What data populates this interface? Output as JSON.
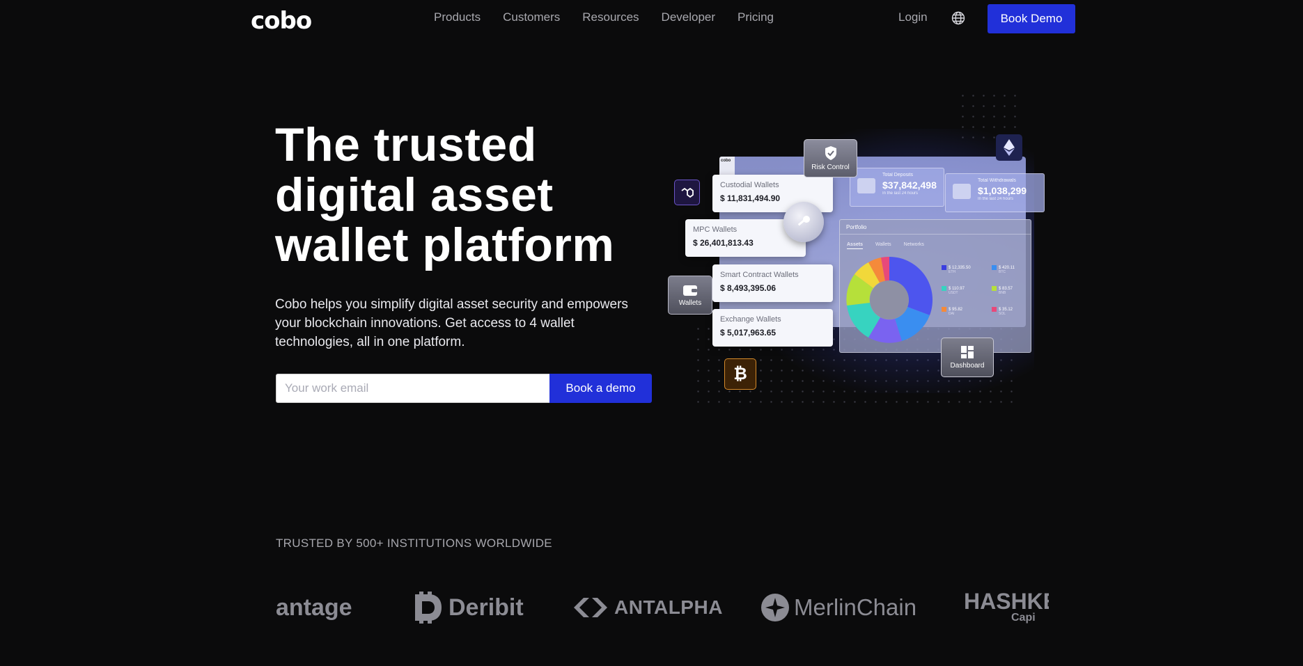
{
  "nav": {
    "logo": "cobo",
    "links": [
      "Products",
      "Customers",
      "Resources",
      "Developer",
      "Pricing"
    ],
    "login": "Login",
    "cta": "Book Demo",
    "globe_icon": "globe-icon"
  },
  "hero": {
    "title_line1": "The trusted",
    "title_line2": "digital asset",
    "title_line3": "wallet platform",
    "subtitle": "Cobo helps you simplify digital asset security and empowers your blockchain innovations. Get access to 4 wallet technologies, all in one platform.",
    "email_placeholder": "Your work email",
    "email_value": "",
    "cta": "Book a demo"
  },
  "illustration": {
    "mini_logo": "cobo",
    "risk_control": "Risk Control",
    "wallets_badge": "Wallets",
    "dashboard_badge": "Dashboard",
    "cards": [
      {
        "label": "Custodial Wallets",
        "value": "$ 11,831,494.90"
      },
      {
        "label": "MPC Wallets",
        "value": "$ 26,401,813.43"
      },
      {
        "label": "Smart Contract Wallets",
        "value": "$ 8,493,395.06"
      },
      {
        "label": "Exchange Wallets",
        "value": "$ 5,017,963.65"
      }
    ],
    "stats": [
      {
        "title": "Total Deposits",
        "value": "$37,842,498",
        "sub": "In the last 24 hours"
      },
      {
        "title": "Total Withdrawals",
        "value": "$1,038,299",
        "sub": "In the last 24 hours"
      }
    ],
    "portfolio": {
      "title": "Portfolio",
      "tabs": [
        "Assets",
        "Wallets",
        "Networks"
      ],
      "legend": [
        {
          "value": "$ 12,335.50",
          "asset": "ETH",
          "color": "#3b3fe0"
        },
        {
          "value": "$ 420.11",
          "asset": "BTC",
          "color": "#3a8ef0"
        },
        {
          "value": "$ 110.97",
          "asset": "USDT",
          "color": "#37d3c0"
        },
        {
          "value": "$ 83.57",
          "asset": "BNB",
          "color": "#b6e03a"
        },
        {
          "value": "$ 95.82",
          "asset": "DAI",
          "color": "#f58a3a"
        },
        {
          "value": "$ 35.12",
          "asset": "SOL",
          "color": "#e8497a"
        }
      ]
    },
    "icons": [
      "polygon-icon",
      "ethereum-icon",
      "bitcoin-icon",
      "shield-check-icon",
      "key-icon",
      "wallet-icon",
      "dashboard-icon"
    ]
  },
  "trusted": {
    "heading": "TRUSTED BY 500+ INSTITUTIONS WORLDWIDE",
    "logos": [
      "antage",
      "Deribit",
      "ANTALPHA",
      "MerlinChain",
      "HASHKE",
      "Capi"
    ]
  }
}
